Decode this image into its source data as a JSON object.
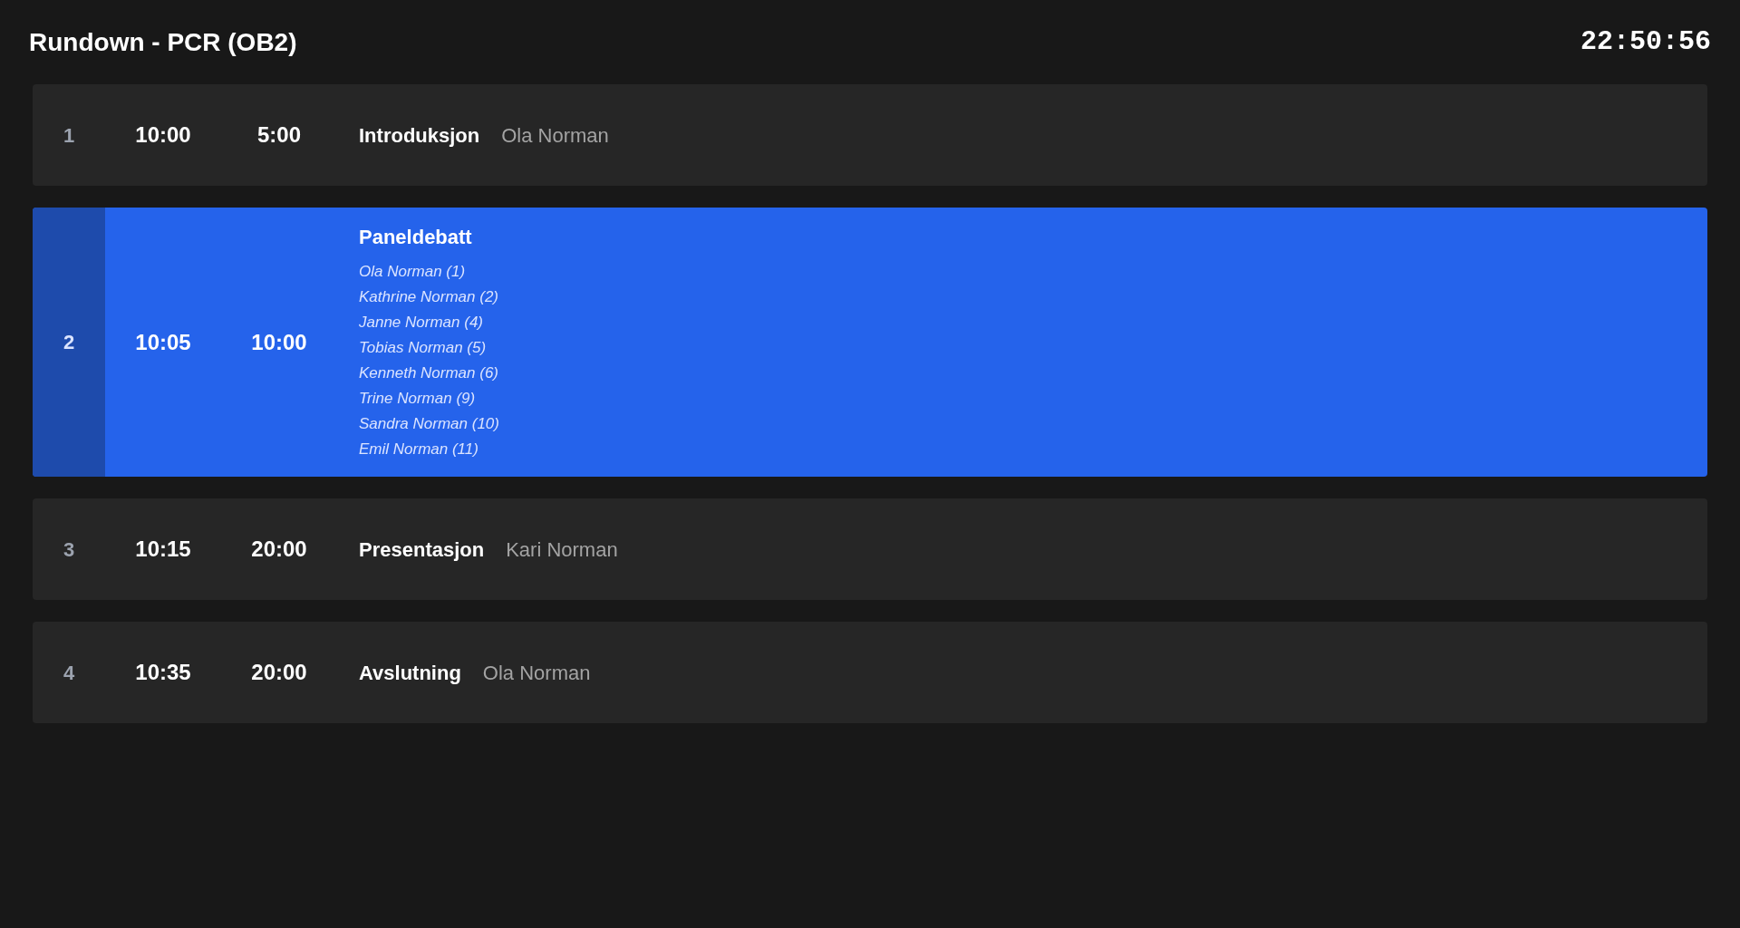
{
  "header": {
    "title": "Rundown - PCR (OB2)",
    "clock": "22:50:56"
  },
  "items": [
    {
      "number": "1",
      "start": "10:00",
      "duration": "5:00",
      "title": "Introduksjon",
      "presenter": "Ola Norman",
      "selected": false
    },
    {
      "number": "2",
      "start": "10:05",
      "duration": "10:00",
      "title": "Paneldebatt",
      "participants": [
        "Ola Norman (1)",
        "Kathrine Norman (2)",
        "Janne Norman (4)",
        "Tobias Norman (5)",
        "Kenneth Norman (6)",
        "Trine Norman (9)",
        "Sandra Norman (10)",
        "Emil Norman (11)"
      ],
      "selected": true
    },
    {
      "number": "3",
      "start": "10:15",
      "duration": "20:00",
      "title": "Presentasjon",
      "presenter": "Kari Norman",
      "selected": false
    },
    {
      "number": "4",
      "start": "10:35",
      "duration": "20:00",
      "title": "Avslutning",
      "presenter": "Ola Norman",
      "selected": false
    }
  ]
}
